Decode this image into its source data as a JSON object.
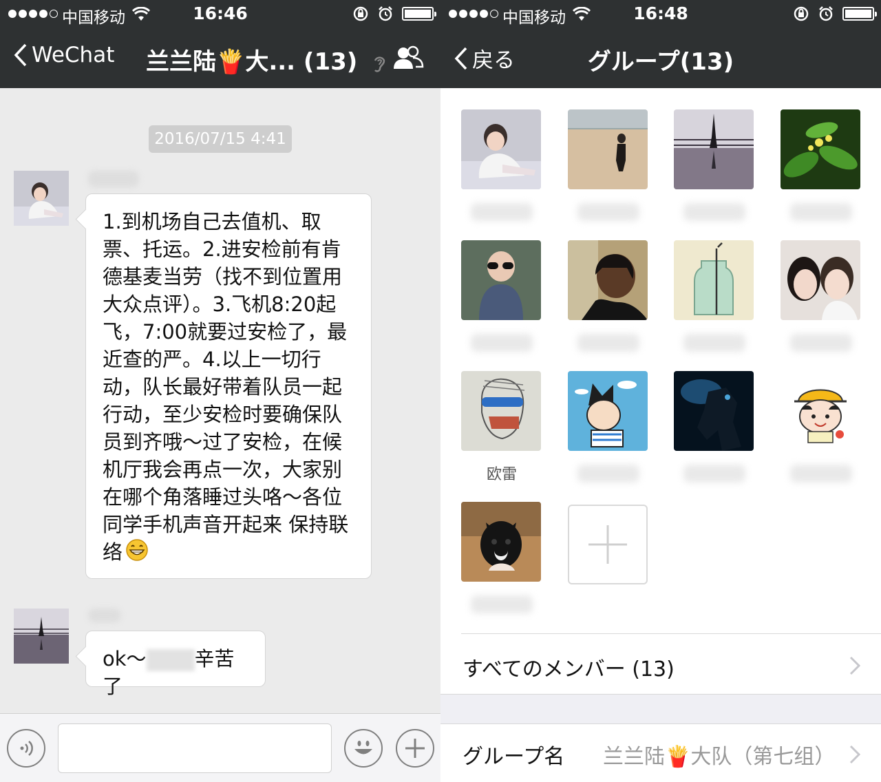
{
  "left": {
    "status": {
      "carrier": "中国移动",
      "time": "16:46"
    },
    "nav": {
      "back_label": "WeChat",
      "title": "兰兰陆🍟大... (13)"
    },
    "chat": {
      "timestamp": "2016/07/15 4:41",
      "messages": [
        {
          "text": "1.到机场自己去值机、取票、托运。2.进安检前有肯德基麦当劳（找不到位置用大众点评）。3.飞机8:20起飞，7:00就要过安检了，最近查的严。4.以上一切行动，队长最好带着队员一起行动，至少安检时要确保队员到齐哦～过了安检，在候机厅我会再点一次，大家别在哪个角落睡过头咯～各位同学手机声音开起来 保持联络"
        },
        {
          "text_before": "ok～",
          "text_after": "辛苦了"
        }
      ]
    },
    "input": {
      "placeholder": ""
    }
  },
  "right": {
    "status": {
      "carrier": "中国移动",
      "time": "16:48"
    },
    "nav": {
      "back_label": "戻る",
      "title": "グループ(13)"
    },
    "members": [
      {
        "name": "",
        "avatar": "girl-on-bed"
      },
      {
        "name": "",
        "avatar": "beach-walker"
      },
      {
        "name": "",
        "avatar": "silhouette-pier"
      },
      {
        "name": "",
        "avatar": "green-plant"
      },
      {
        "name": "",
        "avatar": "child-sunglasses"
      },
      {
        "name": "",
        "avatar": "man-portrait"
      },
      {
        "name": "",
        "avatar": "glass-bottle"
      },
      {
        "name": "",
        "avatar": "couple-selfie"
      },
      {
        "name": "欧雷",
        "avatar": "sketch-goggles"
      },
      {
        "name": "",
        "avatar": "cartoon-astro"
      },
      {
        "name": "",
        "avatar": "dark-robot"
      },
      {
        "name": "",
        "avatar": "cartoon-girl-hat"
      },
      {
        "name": "",
        "avatar": "kitten"
      }
    ],
    "all_members_label": "すべてのメンバー (13)",
    "group_name_label": "グループ名",
    "group_name_value": "兰兰陆🍟大队（第七组）"
  }
}
